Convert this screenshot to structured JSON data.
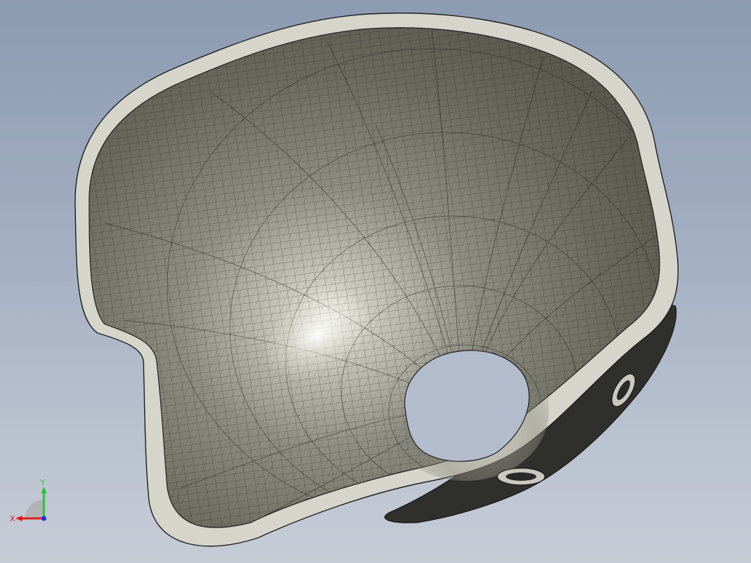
{
  "viewport": {
    "background_top": "#8c9bb2",
    "background_bottom": "#c6ccd6"
  },
  "model": {
    "rim_color": "#d6d5cb",
    "interior_color": "#7d7d72",
    "highlight_color": "#f2f2ea",
    "mesh_color": "#1c1c1c",
    "hole_color": "#b3bccc"
  },
  "triad": {
    "x_label": "X",
    "y_label": "Y",
    "x_color": "#e01b1b",
    "y_color": "#27c23a",
    "z_color": "#1a2fe0"
  }
}
